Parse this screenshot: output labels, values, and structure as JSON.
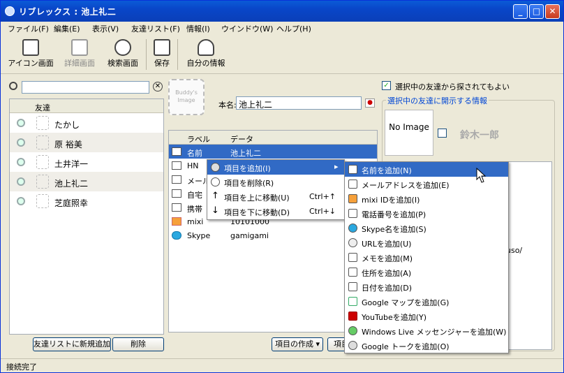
{
  "window": {
    "title": "リブレックス : 池上礼二"
  },
  "menu": [
    "ファイル(F)",
    "編集(E)",
    "表示(V)",
    "友達リスト(F)",
    "情報(I)",
    "ウインドウ(W)",
    "ヘルプ(H)"
  ],
  "toolbar": {
    "icon_view": "アイコン画面",
    "detail_view": "詳細画面",
    "search_view": "検索画面",
    "save": "保存",
    "my_info": "自分の情報"
  },
  "friends": {
    "header": "友達",
    "items": [
      "たかし",
      "原 裕美",
      "土井洋一",
      "池上礼二",
      "芝庭照幸"
    ]
  },
  "left_buttons": {
    "add": "友達リストに新規追加",
    "delete": "削除"
  },
  "profile": {
    "photo_text": "Buddy's Image",
    "name_label": "本名:",
    "name_value": "池上礼二"
  },
  "table": {
    "col_label": "ラベル",
    "col_data": "データ",
    "rows": [
      {
        "label": "名前",
        "value": "池上礼二"
      },
      {
        "label": "HN",
        "value": ""
      },
      {
        "label": "メール",
        "value": ""
      },
      {
        "label": "自宅",
        "value": ""
      },
      {
        "label": "携帯",
        "value": ""
      },
      {
        "label": "mixi",
        "value": "10101000"
      },
      {
        "label": "Skype",
        "value": "gamigami"
      }
    ]
  },
  "center_buttons": {
    "create": "項目の作成",
    "other": "項目"
  },
  "right": {
    "checkbox": "選択中の友達から探されてもよい",
    "group": "選択中の友達に開示する情報",
    "no_image": "No Image",
    "friend_name": "鈴木一郎",
    "partial": "uso/"
  },
  "ctx1": [
    {
      "label": "項目を追加(I)",
      "shortcut": ""
    },
    {
      "label": "項目を削除(R)",
      "shortcut": ""
    },
    {
      "label": "項目を上に移動(U)",
      "shortcut": "Ctrl+↑"
    },
    {
      "label": "項目を下に移動(D)",
      "shortcut": "Ctrl+↓"
    }
  ],
  "ctx2": [
    "名前を追加(N)",
    "メールアドレスを追加(E)",
    "mixi IDを追加(I)",
    "電話番号を追加(P)",
    "Skype名を追加(S)",
    "URLを追加(U)",
    "メモを追加(M)",
    "住所を追加(A)",
    "日付を追加(D)",
    "Google マップを追加(G)",
    "YouTubeを追加(Y)",
    "Windows Live メッセンジャーを追加(W)",
    "Google トークを追加(O)"
  ],
  "status": "接続完了"
}
